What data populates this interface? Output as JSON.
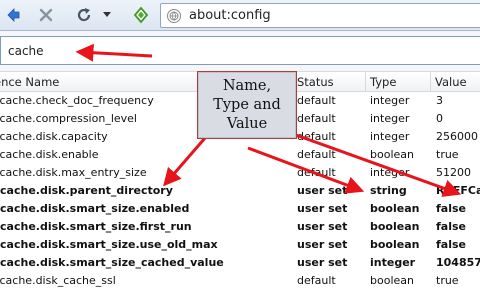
{
  "toolbar": {
    "url": "about:config",
    "back_icon": "back-arrow-icon",
    "stop_icon": "stop-icon",
    "reload_icon": "reload-icon",
    "dropdown_icon": "chevron-down-icon",
    "home_icon": "home-icon"
  },
  "search": {
    "value": "cache"
  },
  "columns": {
    "name": "ence Name",
    "status": "Status",
    "type": "Type",
    "value": "Value"
  },
  "callout": {
    "line1": "Name,",
    "line2": "Type and",
    "line3": "Value"
  },
  "rows": [
    {
      "name": ".cache.check_doc_frequency",
      "status": "default",
      "type": "integer",
      "value": "3",
      "bold": false
    },
    {
      "name": ".cache.compression_level",
      "status": "default",
      "type": "integer",
      "value": "0",
      "bold": false
    },
    {
      "name": ".cache.disk.capacity",
      "status": "default",
      "type": "integer",
      "value": "256000",
      "bold": false
    },
    {
      "name": ".cache.disk.enable",
      "status": "default",
      "type": "boolean",
      "value": "true",
      "bold": false
    },
    {
      "name": ".cache.disk.max_entry_size",
      "status": "default",
      "type": "integer",
      "value": "51200",
      "bold": false
    },
    {
      "name": "r.cache.disk.parent_directory",
      "status": "user set",
      "type": "string",
      "value": "R:\\FFCac",
      "bold": true
    },
    {
      "name": "r.cache.disk.smart_size.enabled",
      "status": "user set",
      "type": "boolean",
      "value": "false",
      "bold": true
    },
    {
      "name": "r.cache.disk.smart_size.first_run",
      "status": "user set",
      "type": "boolean",
      "value": "false",
      "bold": true
    },
    {
      "name": "r.cache.disk.smart_size.use_old_max",
      "status": "user set",
      "type": "boolean",
      "value": "false",
      "bold": true
    },
    {
      "name": "r.cache.disk.smart_size_cached_value",
      "status": "user set",
      "type": "integer",
      "value": "104857",
      "bold": true
    },
    {
      "name": ".cache.disk_cache_ssl",
      "status": "default",
      "type": "boolean",
      "value": "true",
      "bold": false
    }
  ],
  "colors": {
    "annotation_red": "#e8141b",
    "toolbar_blue": "#2f76d3",
    "home_green": "#4caf2a"
  }
}
